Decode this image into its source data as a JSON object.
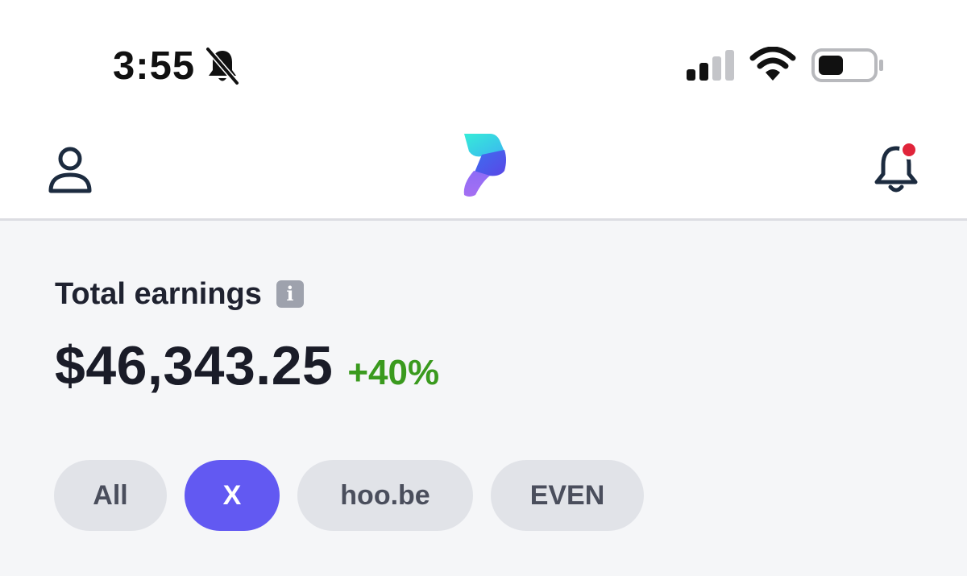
{
  "status_bar": {
    "time": "3:55",
    "icons": [
      "bell-slash-icon",
      "cellular-signal-icon",
      "wifi-icon",
      "battery-icon"
    ]
  },
  "header": {
    "icons": [
      "profile-icon",
      "app-logo",
      "bell-icon"
    ],
    "notification_dot_color": "#e0243a"
  },
  "earnings": {
    "label": "Total earnings",
    "info_glyph": "i",
    "amount": "$46,343.25",
    "change": "+40%"
  },
  "filters": {
    "chips": [
      {
        "label": "All",
        "selected": false
      },
      {
        "label": "X",
        "selected": true
      },
      {
        "label": "hoo.be",
        "selected": false
      },
      {
        "label": "EVEN",
        "selected": false
      }
    ]
  },
  "colors": {
    "accent": "#6259f2",
    "positive": "#3a9a1e",
    "background": "#f5f6f8"
  }
}
